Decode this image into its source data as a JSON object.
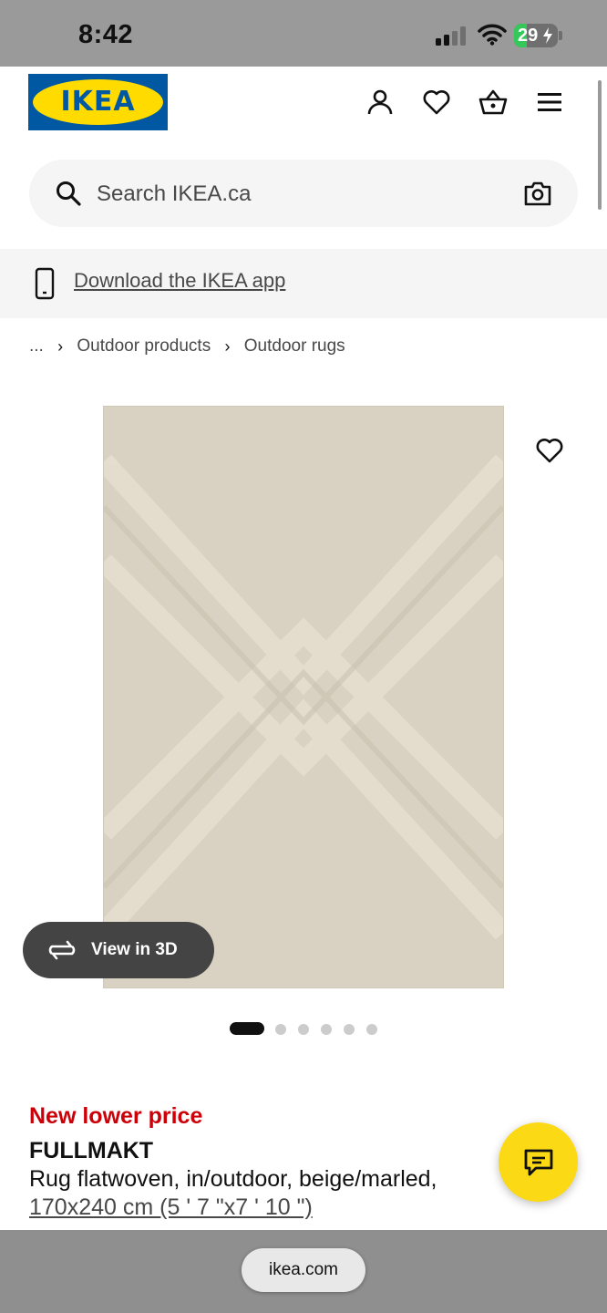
{
  "status_bar": {
    "time": "8:42",
    "battery": "29",
    "battery_level_percent": 29,
    "signal_icon": "cellular-signal-icon",
    "wifi_icon": "wifi-icon"
  },
  "header": {
    "logo_text": "IKEA",
    "logo_reg": "®",
    "icons": [
      "account-icon",
      "wishlist-heart-icon",
      "shopping-bag-icon",
      "menu-hamburger-icon"
    ],
    "colors": {
      "logo_blue": "#0058a3",
      "logo_yellow": "#ffdb00"
    }
  },
  "search": {
    "placeholder": "Search IKEA.ca",
    "search_icon": "search-icon",
    "camera_icon": "camera-icon"
  },
  "app_banner": {
    "icon": "phone-icon",
    "link_text": "Download the IKEA app"
  },
  "breadcrumb": {
    "ellipsis": "...",
    "items": [
      "Outdoor products",
      "Outdoor rugs"
    ],
    "separator_icon": "chevron-right-icon"
  },
  "gallery": {
    "favorite_icon": "heart-icon",
    "view_3d_label": "View in 3D",
    "view_3d_icon": "rotate-3d-icon",
    "image_count": 6,
    "active_index": 0
  },
  "product": {
    "price_note": "New lower price",
    "name": "FULLMAKT",
    "description": "Rug flatwoven, in/outdoor, beige/marled,",
    "size": "170x240 cm (5 ' 7 \"x7 ' 10 \")",
    "colors": {
      "price_note_red": "#cc0008"
    }
  },
  "chat": {
    "icon": "chat-bubble-icon",
    "color": "#fbd914"
  },
  "browser": {
    "url": "ikea.com"
  }
}
